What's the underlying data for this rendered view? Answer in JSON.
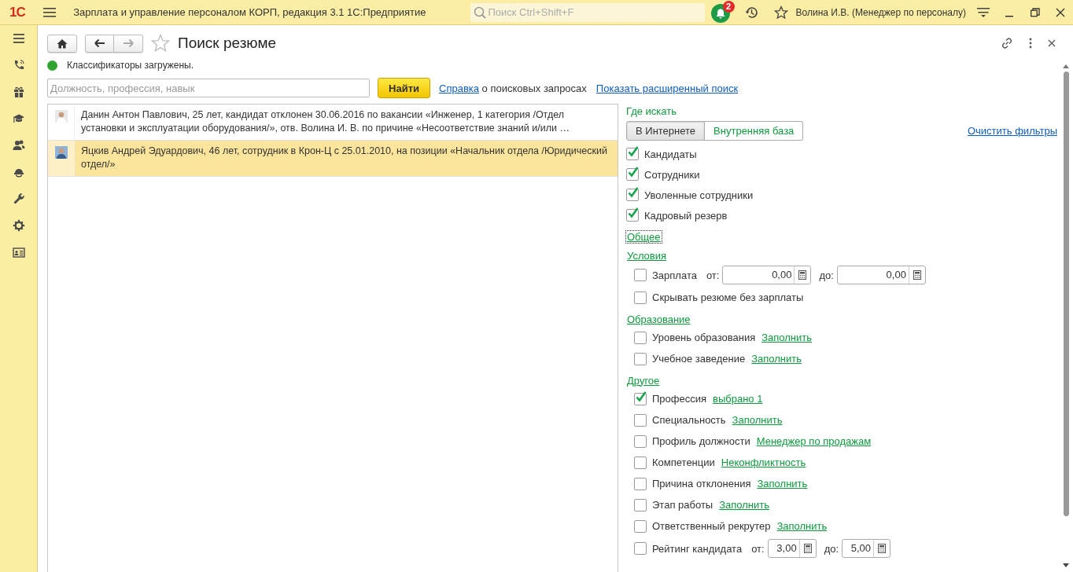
{
  "app_bar": {
    "logo": "1С",
    "title": "Зарплата и управление персоналом КОРП, редакция 3.1 1С:Предприятие",
    "search": {
      "placeholder": "Поиск Ctrl+Shift+F"
    },
    "notifications": "2",
    "user": "Волина И.В. (Менеджер по персоналу)"
  },
  "form": {
    "title": "Поиск резюме",
    "forward_disabled": true,
    "favorite": false,
    "status": {
      "text": "Классификаторы загружены.",
      "color": "#2fa52f"
    },
    "query": {
      "placeholder": "Должность, профессия, навык"
    },
    "find_button": "Найти",
    "help": {
      "link": "Справка",
      "text": " о поисковых запросах"
    },
    "advanced_link": "Показать расширенный поиск",
    "results": [
      {
        "text": "Данин Антон Павлович, 25 лет, кандидат отклонен 30.06.2016 по вакансии «Инженер, 1 категория /Отдел установки и эксплуатации оборудования/», отв. Волина И. В. по причине «Несоответствие знаний и/или …",
        "selected": false
      },
      {
        "text": "Яцкив Андрей Эдуардович, 46 лет, сотрудник в Крон-Ц с 25.01.2010, на позиции «Начальник отдела /Юридический отдел/»",
        "selected": true
      }
    ],
    "where": {
      "label": "Где искать",
      "modes": [
        {
          "label": "В Интернете",
          "selected": true
        },
        {
          "label": "Внутренняя база",
          "selected": false
        }
      ],
      "clear_link": "Очистить фильтры",
      "sources": [
        {
          "label": "Кандидаты",
          "checked": true
        },
        {
          "label": "Сотрудники",
          "checked": true
        },
        {
          "label": "Уволенные сотрудники",
          "checked": true
        },
        {
          "label": "Кадровый резерв",
          "checked": true
        }
      ]
    },
    "sections": [
      {
        "title": "Общее",
        "focused": true
      },
      {
        "title": "Условия",
        "focused": false,
        "items": [
          {
            "kind": "range",
            "label": "Зарплата",
            "checked": false,
            "from_label": "от:",
            "from": "0,00",
            "to_label": "до:",
            "to": "0,00"
          },
          {
            "kind": "plain",
            "label": "Скрывать резюме без зарплаты",
            "checked": false
          }
        ]
      },
      {
        "title": "Образование",
        "focused": false,
        "items": [
          {
            "kind": "link",
            "label": "Уровень образования",
            "checked": false,
            "link": "Заполнить"
          },
          {
            "kind": "link",
            "label": "Учебное заведение",
            "checked": false,
            "link": "Заполнить"
          }
        ]
      },
      {
        "title": "Другое",
        "focused": false,
        "items": [
          {
            "kind": "link",
            "label": "Профессия",
            "checked": true,
            "link": "выбрано 1"
          },
          {
            "kind": "link",
            "label": "Специальность",
            "checked": false,
            "link": "Заполнить"
          },
          {
            "kind": "link",
            "label": "Профиль должности",
            "checked": false,
            "link": "Менеджер по продажам"
          },
          {
            "kind": "link",
            "label": "Компетенции",
            "checked": false,
            "link": "Неконфликтность"
          },
          {
            "kind": "link",
            "label": "Причина отклонения",
            "checked": false,
            "link": "Заполнить"
          },
          {
            "kind": "link",
            "label": "Этап работы",
            "checked": false,
            "link": "Заполнить"
          },
          {
            "kind": "link",
            "label": "Ответственный рекрутер",
            "checked": false,
            "link": "Заполнить"
          },
          {
            "kind": "range",
            "label": "Рейтинг кандидата",
            "checked": false,
            "from_label": "от:",
            "from": "3,00",
            "to_label": "до:",
            "to": "5,00"
          }
        ]
      }
    ]
  }
}
